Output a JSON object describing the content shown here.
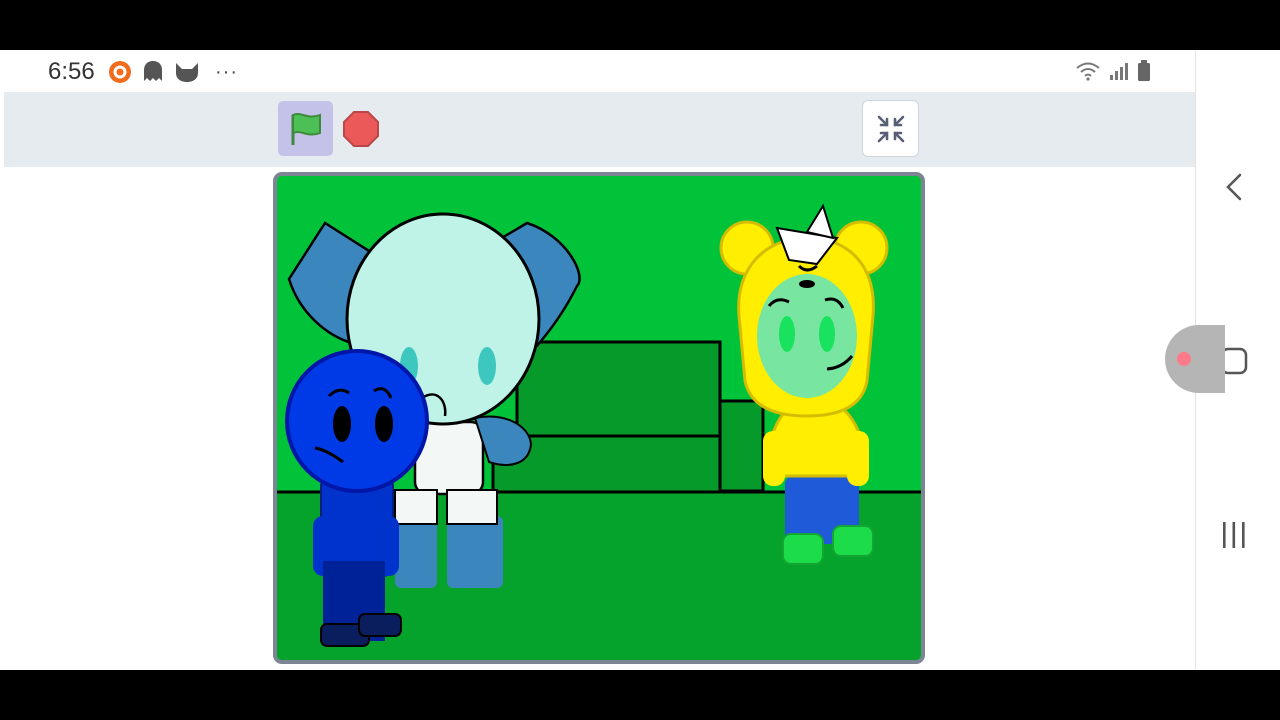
{
  "status_bar": {
    "time": "6:56",
    "left_icons": [
      "camera-app-icon",
      "ghost-app-icon",
      "cat-app-icon"
    ],
    "more": "···",
    "right_icons": [
      "wifi-icon",
      "signal-icon",
      "battery-icon"
    ]
  },
  "toolbar": {
    "green_flag_icon": "green-flag-icon",
    "stop_icon": "stop-sign-icon",
    "fullscreen_icon": "exit-fullscreen-icon"
  },
  "stage": {
    "characters": [
      "light-blue-robot",
      "blue-round-head-character",
      "yellow-hooded-character"
    ],
    "colors": {
      "wall": "#00c33a",
      "floor": "#05a32b",
      "couch": "#059a2a",
      "robot_ears": "#3b87bd",
      "robot_head": "#bff3e8",
      "blue_character": "#0039e6",
      "yellow_hood": "#ffee00",
      "green_face": "#78e6a0"
    }
  },
  "navigation": {
    "back_icon": "back-chevron-icon",
    "home_icon": "home-square-icon",
    "recents_icon": "recents-bars-icon"
  }
}
